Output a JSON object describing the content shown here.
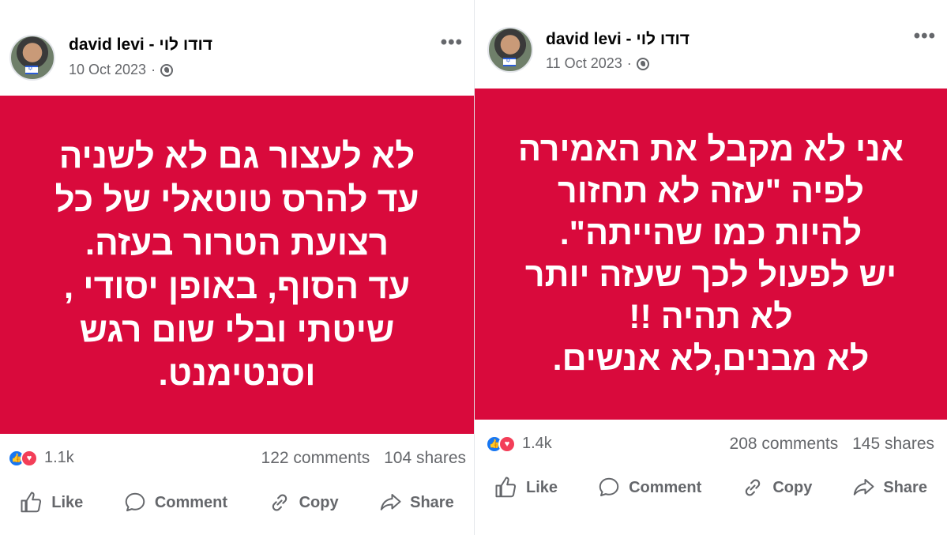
{
  "posts": [
    {
      "author": "david levi - דודו לוי",
      "date": "10 Oct 2023",
      "more_icon": "more-dots-icon",
      "visibility_icon": "globe-icon",
      "text": "לא לעצור גם לא לשניה\nעד להרס טוטאלי של כל\nרצועת הטרור בעזה.\nעד הסוף, באופן יסודי ,\nשיטתי ובלי שום רגש\nוסנטימנט.",
      "background_color": "#d90a3c",
      "reactions_count": "1.1k",
      "comments": "122 comments",
      "shares": "104 shares",
      "actions": {
        "like": "Like",
        "comment": "Comment",
        "copy": "Copy",
        "share": "Share"
      }
    },
    {
      "author": "david levi - דודו לוי",
      "date": "11 Oct 2023",
      "more_icon": "more-dots-icon",
      "visibility_icon": "globe-icon",
      "text": "אני לא מקבל את האמירה\nלפיה \"עזה לא תחזור\nלהיות כמו שהייתה\".\nיש לפעול לכך שעזה יותר\nלא תהיה !!\nלא מבנים,לא  אנשים.",
      "background_color": "#d90a3c",
      "reactions_count": "1.4k",
      "comments": "208 comments",
      "shares": "145 shares",
      "actions": {
        "like": "Like",
        "comment": "Comment",
        "copy": "Copy",
        "share": "Share"
      }
    }
  ],
  "colors": {
    "accent_like": "#1877f2",
    "accent_love": "#f33e58",
    "muted_text": "#65676b"
  }
}
